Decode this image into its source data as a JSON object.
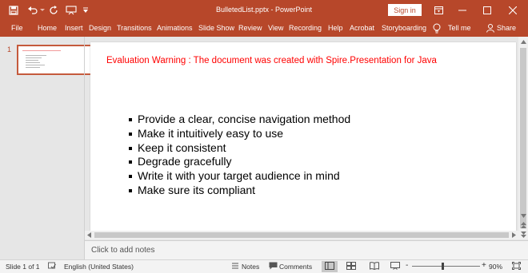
{
  "titlebar": {
    "doc_title": "BulletedList.pptx  -  PowerPoint",
    "signin_label": "Sign in"
  },
  "ribbon": {
    "tabs": [
      "File",
      "Home",
      "Insert",
      "Design",
      "Transitions",
      "Animations",
      "Slide Show",
      "Review",
      "View",
      "Recording",
      "Help",
      "Acrobat",
      "Storyboarding"
    ],
    "tell_me": "Tell me",
    "share": "Share"
  },
  "thumbnails": {
    "slide_number": "1"
  },
  "slide": {
    "warning": "Evaluation Warning : The document was created with  Spire.Presentation for Java",
    "bullets": [
      "Provide a clear, concise navigation method",
      "Make it intuitively easy to use",
      "Keep it consistent",
      "Degrade gracefully",
      "Write it with your target audience in mind",
      "Make sure its compliant"
    ]
  },
  "notes": {
    "placeholder": "Click to add notes"
  },
  "status": {
    "slide_info": "Slide 1 of 1",
    "language": "English (United States)",
    "notes": "Notes",
    "comments": "Comments",
    "zoom": "90%",
    "zoom_minus": "-",
    "zoom_plus": "+"
  },
  "colors": {
    "accent": "#b7472a",
    "warning": "#ff0000"
  },
  "icons": [
    "save-icon",
    "undo-icon",
    "redo-icon",
    "start-from-beginning-icon",
    "customize-qat-icon",
    "ribbon-display-icon",
    "minimize-icon",
    "restore-icon",
    "close-icon",
    "lightbulb-icon",
    "person-icon",
    "spellcheck-icon",
    "notes-icon",
    "comments-icon",
    "normal-view-icon",
    "slide-sorter-icon",
    "reading-view-icon",
    "slideshow-icon",
    "fit-to-window-icon"
  ]
}
